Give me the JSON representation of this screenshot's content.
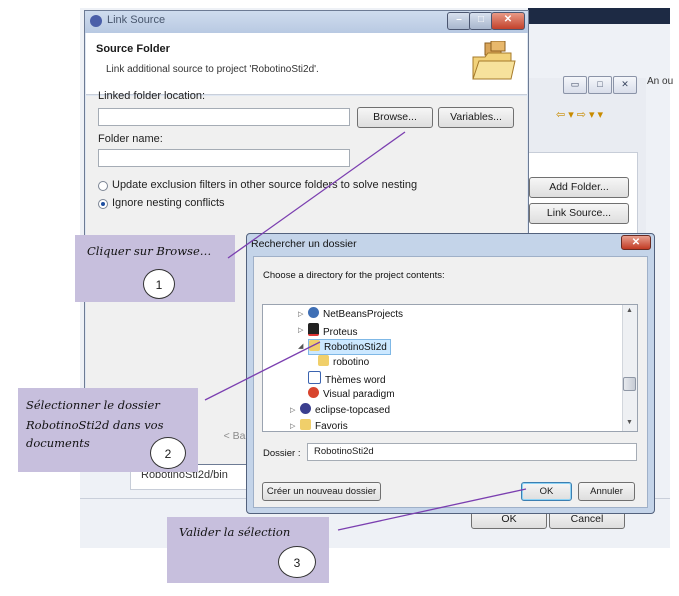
{
  "background": {
    "bin_text": "RobotinoSti2d/bin",
    "ok_label": "OK",
    "cancel_label": "Cancel",
    "add_folder_label": "Add Folder...",
    "link_source_label": "Link Source...",
    "corner_text": "An ou"
  },
  "link_source": {
    "title": "Link Source",
    "header_title": "Source Folder",
    "header_desc": "Link additional source to project 'RobotinoSti2d'.",
    "linked_label": "Linked folder location:",
    "linked_value": "",
    "browse_label": "Browse...",
    "variables_label": "Variables...",
    "folder_name_label": "Folder name:",
    "folder_name_value": "",
    "option_update": "Update exclusion filters in other source folders to solve nesting",
    "option_ignore": "Ignore nesting conflicts",
    "selected_option": "Ignore nesting conflicts",
    "back_label": "< Back",
    "help_label": "?"
  },
  "rechercher": {
    "title": "Rechercher un dossier",
    "description": "Choose a directory for the project contents:",
    "tree": [
      {
        "label": "NetBeansProjects",
        "icon": "globe-icon",
        "expand": "closed"
      },
      {
        "label": "Proteus",
        "icon": "proteus-icon",
        "expand": "closed"
      },
      {
        "label": "RobotinoSti2d",
        "icon": "folder-icon",
        "expand": "open",
        "selected": true
      },
      {
        "label": "robotino",
        "icon": "folder-icon",
        "expand": "none"
      },
      {
        "label": "Thèmes word",
        "icon": "word-icon",
        "expand": "none"
      },
      {
        "label": "Visual paradigm",
        "icon": "vp-icon",
        "expand": "none"
      },
      {
        "label": "eclipse-topcased",
        "icon": "eclipse-icon",
        "expand": "closed"
      },
      {
        "label": "Favoris",
        "icon": "star-folder-icon",
        "expand": "closed"
      }
    ],
    "folder_label": "Dossier :",
    "folder_value": "RobotinoSti2d",
    "new_folder_label": "Créer un nouveau dossier",
    "ok_label": "OK",
    "cancel_label": "Annuler"
  },
  "annotations": [
    {
      "text": "Cliquer sur Browse…",
      "number": "1"
    },
    {
      "text_line1": "Sélectionner le dossier",
      "text_line2": "RobotinoSti2d dans vos",
      "text_line3": "documents",
      "number": "2"
    },
    {
      "text": "Valider la sélection",
      "number": "3"
    }
  ],
  "colors": {
    "annotation_bg": "#c7bfdd",
    "annotation_line": "#7b3fb0",
    "selection": "#cce8ff"
  }
}
